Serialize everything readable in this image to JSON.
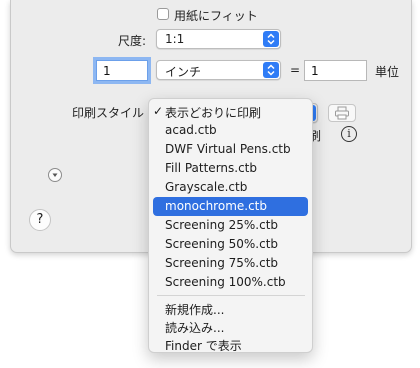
{
  "fit_checkbox": {
    "label": "用紙にフィット",
    "checked": false
  },
  "scale": {
    "label": "尺度:",
    "selected": "1:1"
  },
  "units": {
    "value_left": "1",
    "unit_selected": "インチ",
    "equals": "=",
    "value_right": "1",
    "unit_label": "単位"
  },
  "plot_style": {
    "label": "印刷スタイル",
    "partial_label": "刷"
  },
  "icons": {
    "info": "i",
    "help": "?"
  },
  "menu": {
    "items": [
      {
        "label": "表示どおりに印刷",
        "checked": true,
        "check_glyph": "✓"
      },
      {
        "label": "acad.ctb"
      },
      {
        "label": "DWF Virtual Pens.ctb"
      },
      {
        "label": "Fill Patterns.ctb"
      },
      {
        "label": "Grayscale.ctb"
      },
      {
        "label": "monochrome.ctb",
        "highlighted": true
      },
      {
        "label": "Screening 25%.ctb"
      },
      {
        "label": "Screening 50%.ctb"
      },
      {
        "label": "Screening 75%.ctb"
      },
      {
        "label": "Screening 100%.ctb"
      }
    ],
    "actions": [
      {
        "label": "新規作成..."
      },
      {
        "label": "読み込み..."
      },
      {
        "label": "Finder で表示"
      }
    ]
  },
  "colors": {
    "accent": "#2f6fe0",
    "stepper": "#2f7cf6",
    "sheet_bg": "#ececec"
  }
}
